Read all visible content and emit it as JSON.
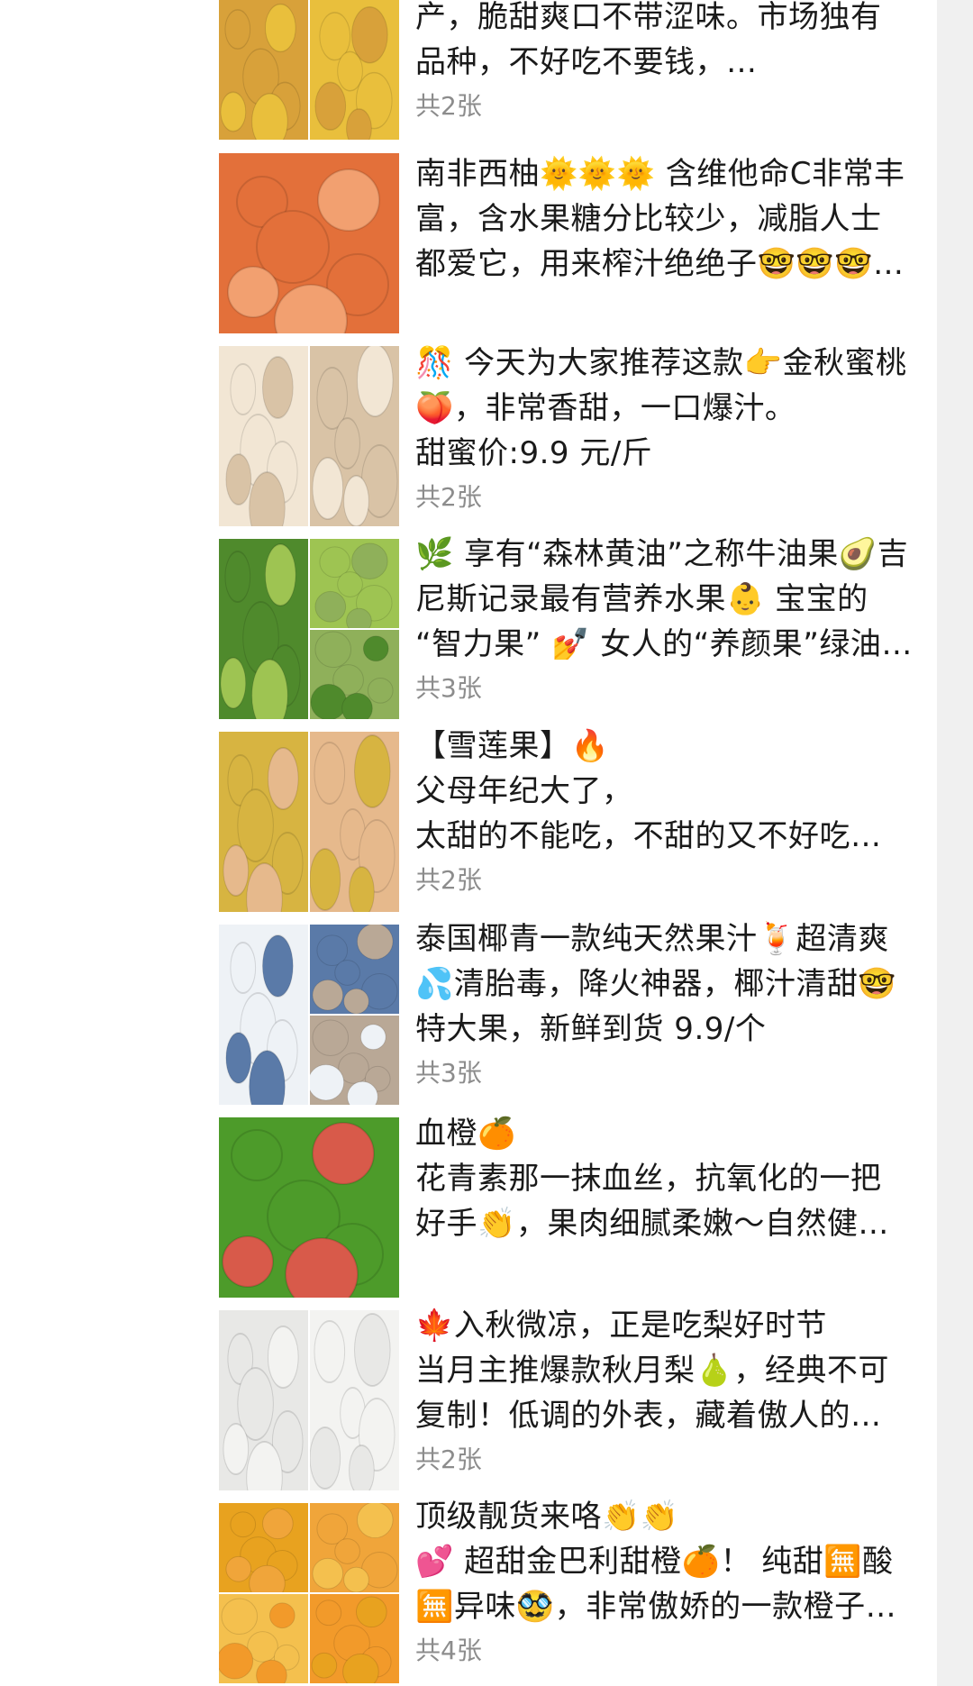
{
  "posts": [
    {
      "lines": [
        "产，脆甜爽口不带涩味。市场独有",
        "品种，不好吃不要钱，…"
      ],
      "count": "共2张",
      "photos": [
        "persimmon-tile",
        "sliced-persimmon-tile"
      ]
    },
    {
      "lines": [
        "南非西柚🌞🌞🌞 含维他命C非常丰",
        "富，含水果糖分比较少，减脂人士",
        "都爱它，用来榨汁绝绝子🤓🤓🤓…"
      ],
      "count": "",
      "photos": [
        "grapefruit-tile"
      ]
    },
    {
      "lines": [
        "🎊 今天为大家推荐这款👉金秋蜜桃",
        "🍑，非常香甜，一口爆汁。",
        "甜蜜价:9.9 元/斤"
      ],
      "count": "共2张",
      "photos": [
        "peach-tile",
        "wrapped-peach-tile"
      ]
    },
    {
      "lines": [
        "🌿 享有“森林黄油”之称牛油果🥑吉",
        "尼斯记录最有营养水果👶 宝宝的",
        "“智力果” 💅 女人的“养颜果”绿油…"
      ],
      "count": "共3张",
      "photos": [
        "avocado-tile",
        "sliced-avocado-tile",
        "avocado-flesh-tile"
      ]
    },
    {
      "lines": [
        "【雪莲果】🔥",
        "父母年纪大了，",
        "太甜的不能吃，不甜的又不好吃…"
      ],
      "count": "共2张",
      "photos": [
        "yacon-tile",
        "peeled-yacon-tile"
      ]
    },
    {
      "lines": [
        "泰国椰青一款纯天然果汁🍹超清爽",
        "💦清胎毒，降火神器，椰汁清甜🤓",
        "特大果，新鲜到货 9.9/个"
      ],
      "count": "共3张",
      "photos": [
        "coconut-tile",
        "coconut-box-tile",
        "coconut-cup-tile"
      ]
    },
    {
      "lines": [
        "血橙🍊",
        "花青素那一抹血丝，抗氧化的一把",
        "好手👏，果肉细腻柔嫩～自然健…"
      ],
      "count": "",
      "photos": [
        "blood-orange-tile"
      ]
    },
    {
      "lines": [
        "🍁入秋微凉，正是吃梨好时节",
        "当月主推爆款秋月梨🍐，经典不可",
        "复制！低调的外表，藏着傲人的…"
      ],
      "count": "共2张",
      "photos": [
        "pear-tile",
        "pear-flesh-tile"
      ]
    },
    {
      "lines": [
        "顶级靓货来咯👏👏",
        "💕 超甜金巴利甜橙🍊！ 纯甜🈚酸",
        "🈚异味🥸，非常傲娇的一款橙子…"
      ],
      "count": "共4张",
      "photos": [
        "orange-tile",
        "orange-half-tile",
        "orange-segment-tile",
        "orange-plate-tile"
      ]
    }
  ]
}
